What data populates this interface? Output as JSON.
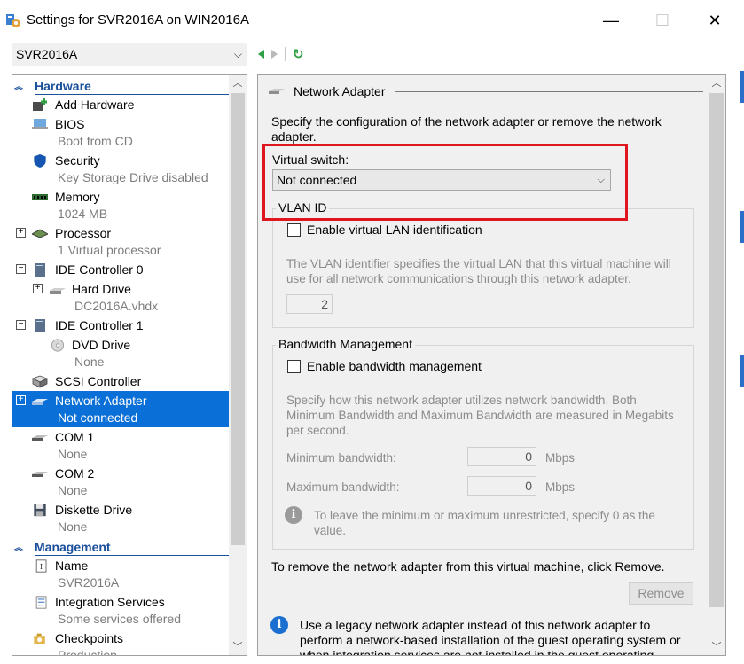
{
  "window": {
    "title": "Settings for SVR2016A on WIN2016A",
    "minimize": "—",
    "maximize": "☐",
    "close": "✕"
  },
  "vm_selector": {
    "value": "SVR2016A",
    "chevron": "⌵"
  },
  "nav": {
    "refresh_glyph": "↻"
  },
  "tree": {
    "hardware_label": "Hardware",
    "management_label": "Management",
    "items": [
      {
        "label": "Add Hardware",
        "sub": ""
      },
      {
        "label": "BIOS",
        "sub": "Boot from CD"
      },
      {
        "label": "Security",
        "sub": "Key Storage Drive disabled"
      },
      {
        "label": "Memory",
        "sub": "1024 MB"
      },
      {
        "label": "Processor",
        "sub": "1 Virtual processor"
      },
      {
        "label": "IDE Controller 0",
        "sub": ""
      },
      {
        "label": "Hard Drive",
        "sub": "DC2016A.vhdx"
      },
      {
        "label": "IDE Controller 1",
        "sub": ""
      },
      {
        "label": "DVD Drive",
        "sub": "None"
      },
      {
        "label": "SCSI Controller",
        "sub": ""
      },
      {
        "label": "Network Adapter",
        "sub": "Not connected"
      },
      {
        "label": "COM 1",
        "sub": "None"
      },
      {
        "label": "COM 2",
        "sub": "None"
      },
      {
        "label": "Diskette Drive",
        "sub": "None"
      },
      {
        "label": "Name",
        "sub": "SVR2016A"
      },
      {
        "label": "Integration Services",
        "sub": "Some services offered"
      },
      {
        "label": "Checkpoints",
        "sub": "Production"
      }
    ]
  },
  "panel": {
    "section_title": "Network Adapter",
    "intro": "Specify the configuration of the network adapter or remove the network adapter.",
    "virtual_switch_label": "Virtual switch:",
    "virtual_switch_value": "Not connected",
    "vlan": {
      "group_label": "VLAN ID",
      "checkbox_label": "Enable virtual LAN identification",
      "description": "The VLAN identifier specifies the virtual LAN that this virtual machine will use for all network communications through this network adapter.",
      "value": "2"
    },
    "bandwidth": {
      "group_label": "Bandwidth Management",
      "checkbox_label": "Enable bandwidth management",
      "description": "Specify how this network adapter utilizes network bandwidth. Both Minimum Bandwidth and Maximum Bandwidth are measured in Megabits per second.",
      "min_label": "Minimum bandwidth:",
      "min_value": "0",
      "max_label": "Maximum bandwidth:",
      "max_value": "0",
      "unit": "Mbps",
      "info": "To leave the minimum or maximum unrestricted, specify 0 as the value."
    },
    "remove_text": "To remove the network adapter from this virtual machine, click Remove.",
    "remove_button": "Remove",
    "legacy_info": "Use a legacy network adapter instead of this network adapter to perform a network-based installation of the guest operating system or when integration services are not installed in the guest operating"
  },
  "colors": {
    "selection": "#0a6fd6",
    "category": "#1a4f9c",
    "highlight_box": "#e0161e",
    "nav_green": "#2ea043"
  }
}
